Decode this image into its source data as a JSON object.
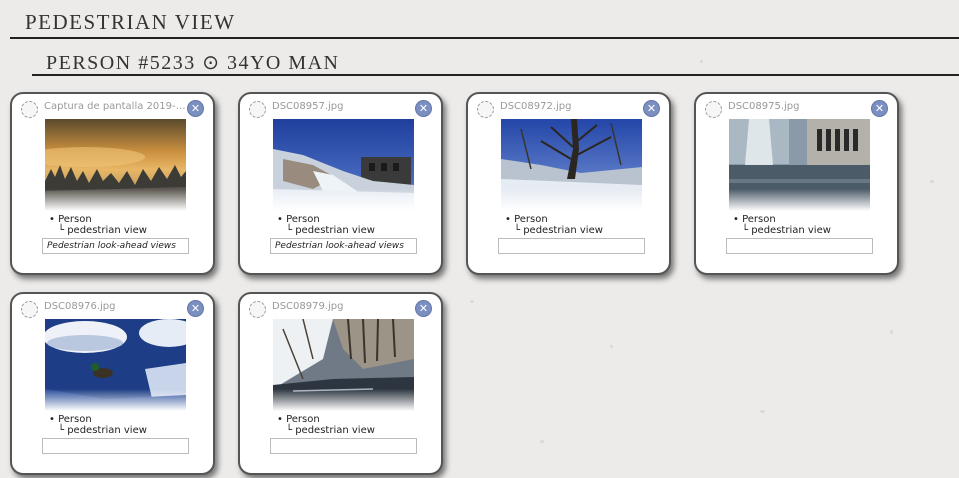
{
  "header": {
    "title": "PEDESTRIAN VIEW",
    "subtitle": "PERSON #5233 ⊙ 34YO MAN"
  },
  "cards": [
    {
      "filename": "Captura de pantalla 2019-0...",
      "tag": "Person",
      "subtag": "pedestrian view",
      "caption_value": "Pedestrian look-ahead views",
      "close_icon": "close-circle-icon"
    },
    {
      "filename": "DSC08957.jpg",
      "tag": "Person",
      "subtag": "pedestrian view",
      "caption_value": "Pedestrian look-ahead views",
      "close_icon": "close-circle-icon"
    },
    {
      "filename": "DSC08972.jpg",
      "tag": "Person",
      "subtag": "pedestrian view",
      "caption_value": "",
      "close_icon": "close-circle-icon"
    },
    {
      "filename": "DSC08975.jpg",
      "tag": "Person",
      "subtag": "pedestrian view",
      "caption_value": "",
      "close_icon": "close-circle-icon"
    },
    {
      "filename": "DSC08976.jpg",
      "tag": "Person",
      "subtag": "pedestrian view",
      "caption_value": "",
      "close_icon": "close-circle-icon"
    },
    {
      "filename": "DSC08979.jpg",
      "tag": "Person",
      "subtag": "pedestrian view",
      "caption_value": "",
      "close_icon": "close-circle-icon"
    }
  ],
  "colors": {
    "background": "#ecebea",
    "card_border": "#555555",
    "close_button": "#7b8fc0",
    "filename_text": "#999999"
  }
}
